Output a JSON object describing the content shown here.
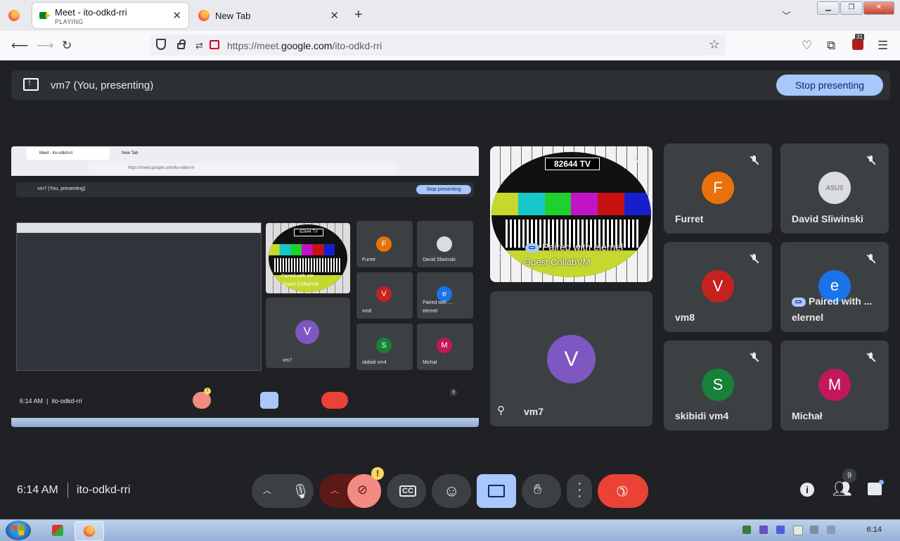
{
  "browser": {
    "tabs": [
      {
        "title": "Meet - ito-odkd-rri",
        "subtitle": "PLAYING"
      },
      {
        "title": "New Tab"
      }
    ],
    "url_prefix": "https://meet.",
    "url_domain": "google.com",
    "url_path": "/ito-odkd-rri",
    "extension_badge": "31"
  },
  "meet": {
    "presenting_text": "vm7 (You, presenting)",
    "stop_presenting": "Stop presenting",
    "screen_share": {
      "tab1": "Meet - ito-odkd-rri",
      "tab2": "New Tab",
      "url": "https://meet.google.com/ito-odkd-rri",
      "presenting_text": "vm7 (You, presenting)",
      "stop_presenting": "Stop presenting",
      "tv_label": "82644 TV",
      "tv_pair": "Paired with ele",
      "tv_guest": "Guest CollabVM",
      "vm7": "vm7",
      "participants": [
        {
          "initial": "F",
          "name": "Furret",
          "color": "#e8710a"
        },
        {
          "initial": "",
          "name": "David Sliwinski",
          "color": "#dadce0"
        },
        {
          "initial": "V",
          "name": "vm8",
          "color": "#c5221f"
        },
        {
          "initial": "e",
          "name": "elernel",
          "color": "#1a73e8",
          "pair": "Paired with ..."
        },
        {
          "initial": "S",
          "name": "skibidi vm4",
          "color": "#188038"
        },
        {
          "initial": "M",
          "name": "Michał",
          "color": "#c2185b"
        }
      ],
      "time": "6:14 AM",
      "code": "ito-odkd-rri",
      "warn": "!",
      "count": "9"
    },
    "tv_tile": {
      "label": "82644 TV",
      "pair": "Paired with elernel",
      "guest": "Guest CollabVM"
    },
    "self_tile": {
      "initial": "V",
      "name": "vm7",
      "color": "#7e57c2"
    },
    "participants": [
      {
        "initial": "F",
        "name": "Furret",
        "color": "#e8710a"
      },
      {
        "initial": "",
        "name": "David Sliwinski",
        "color": "#dadce0",
        "avatar_text": "ASUS"
      },
      {
        "initial": "V",
        "name": "vm8",
        "color": "#c5221f"
      },
      {
        "initial": "e",
        "name": "elernel",
        "color": "#1a73e8",
        "pair": "Paired with ..."
      },
      {
        "initial": "S",
        "name": "skibidi vm4",
        "color": "#188038"
      },
      {
        "initial": "M",
        "name": "Michał",
        "color": "#c2185b"
      }
    ],
    "bottom": {
      "time": "6:14 AM",
      "code": "ito-odkd-rri",
      "warn": "!",
      "people_count": "9"
    }
  },
  "taskbar": {
    "clock": "6:14"
  },
  "colors": {
    "accent": "#a8c7fa",
    "leave": "#ea4335",
    "tile": "#3c4043",
    "bg": "#202124"
  },
  "icons": [
    "firefox-icon",
    "meet-icon",
    "close-icon",
    "new-tab-icon",
    "back-icon",
    "forward-icon",
    "reload-icon",
    "shield-icon",
    "lock-icon",
    "camera-blocked-icon",
    "star-icon",
    "pocket-icon",
    "extensions-icon",
    "menu-icon",
    "present-icon",
    "mic-off-icon",
    "pin-icon",
    "mic-icon",
    "camera-off-icon",
    "captions-icon",
    "emoji-icon",
    "present-screen-icon",
    "raise-hand-icon",
    "more-icon",
    "hang-up-icon",
    "info-icon",
    "people-icon",
    "chat-icon"
  ]
}
